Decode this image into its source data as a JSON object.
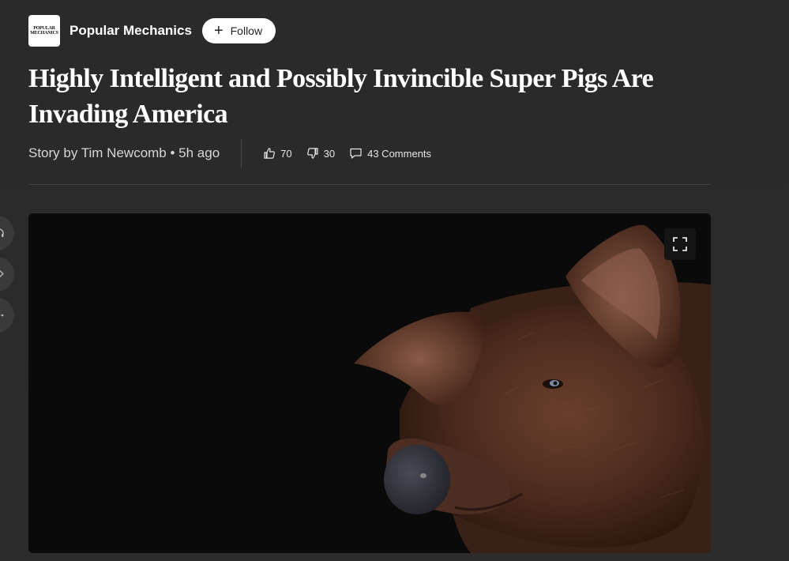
{
  "publisher": {
    "logo_text": [
      "POPULAR",
      "MECHANICS"
    ],
    "name": "Popular Mechanics",
    "follow_label": "Follow"
  },
  "article": {
    "headline": "Highly Intelligent and Possibly Invincible Super Pigs Are Invading America",
    "byline": "Story by Tim Newcomb • 5h ago"
  },
  "reactions": {
    "likes": "70",
    "dislikes": "30",
    "comments": "43 Comments"
  },
  "hero_image": {
    "subject": "pig",
    "background_color": "#0a0a0a"
  },
  "side_rail": {
    "icons": [
      "headphones-icon",
      "share-icon",
      "more-icon"
    ]
  }
}
